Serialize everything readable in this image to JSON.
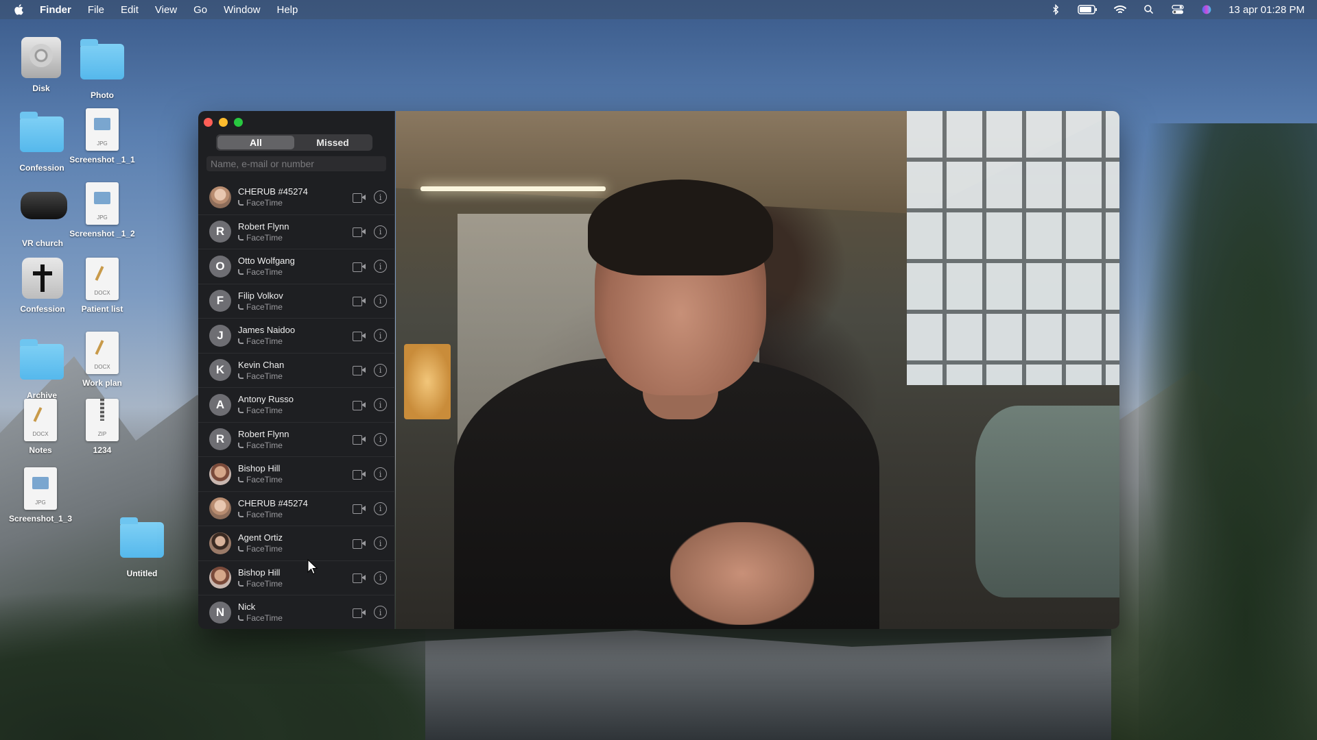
{
  "menubar": {
    "app_name": "Finder",
    "menus": [
      "File",
      "Edit",
      "View",
      "Go",
      "Window",
      "Help"
    ],
    "clock": "13 apr  01:28 PM"
  },
  "desktop": {
    "icons": [
      {
        "label": "Disk",
        "type": "disk"
      },
      {
        "label": "Photo",
        "type": "folder"
      },
      {
        "label": "Confession",
        "type": "folder"
      },
      {
        "label": "Screenshot _1_1",
        "type": "jpg",
        "tag": "JPG"
      },
      {
        "label": "VR church",
        "type": "vr"
      },
      {
        "label": "Screenshot _1_2",
        "type": "jpg",
        "tag": "JPG"
      },
      {
        "label": "Confession",
        "type": "cross"
      },
      {
        "label": "Patient list",
        "type": "docx",
        "tag": "DOCX"
      },
      {
        "label": "Archive",
        "type": "folder"
      },
      {
        "label": "Work plan",
        "type": "docx",
        "tag": "DOCX"
      },
      {
        "label": "Notes",
        "type": "docx",
        "tag": "DOCX"
      },
      {
        "label": "1234",
        "type": "zip",
        "tag": "ZIP"
      },
      {
        "label": "Screenshot_1_3",
        "type": "jpg",
        "tag": "JPG"
      },
      {
        "label": "Untitled",
        "type": "folder"
      }
    ]
  },
  "facetime": {
    "tabs": {
      "all": "All",
      "missed": "Missed"
    },
    "search_placeholder": "Name, e-mail or number",
    "contacts": [
      {
        "name": "CHERUB #45274",
        "sub": "FaceTime",
        "avatar": "",
        "photo": "photo"
      },
      {
        "name": "Robert Flynn",
        "sub": "FaceTime",
        "avatar": "R"
      },
      {
        "name": "Otto Wolfgang",
        "sub": "FaceTime",
        "avatar": "O"
      },
      {
        "name": "Filip Volkov",
        "sub": "FaceTime",
        "avatar": "F"
      },
      {
        "name": "James Naidoo",
        "sub": "FaceTime",
        "avatar": "J"
      },
      {
        "name": "Kevin Chan",
        "sub": "FaceTime",
        "avatar": "K"
      },
      {
        "name": "Antony Russo",
        "sub": "FaceTime",
        "avatar": "A"
      },
      {
        "name": "Robert Flynn",
        "sub": "FaceTime",
        "avatar": "R"
      },
      {
        "name": "Bishop Hill",
        "sub": "FaceTime",
        "avatar": "",
        "photo": "photo3"
      },
      {
        "name": "CHERUB #45274",
        "sub": "FaceTime",
        "avatar": "",
        "photo": "photo"
      },
      {
        "name": "Agent Ortiz",
        "sub": "FaceTime",
        "avatar": "",
        "photo": "photo2"
      },
      {
        "name": "Bishop Hill",
        "sub": "FaceTime",
        "avatar": "",
        "photo": "photo3"
      },
      {
        "name": "Nick",
        "sub": "FaceTime",
        "avatar": "N"
      }
    ]
  },
  "colors": {
    "close": "#ff5f57",
    "minimize": "#febc2e",
    "maximize": "#28c840",
    "sidebar_bg": "#1e1f22",
    "segment_active": "#636366"
  },
  "icons": [
    "apple-icon",
    "bluetooth-icon",
    "battery-icon",
    "wifi-icon",
    "search-icon",
    "control-center-icon",
    "siri-icon",
    "video-icon",
    "info-icon",
    "phone-icon"
  ]
}
